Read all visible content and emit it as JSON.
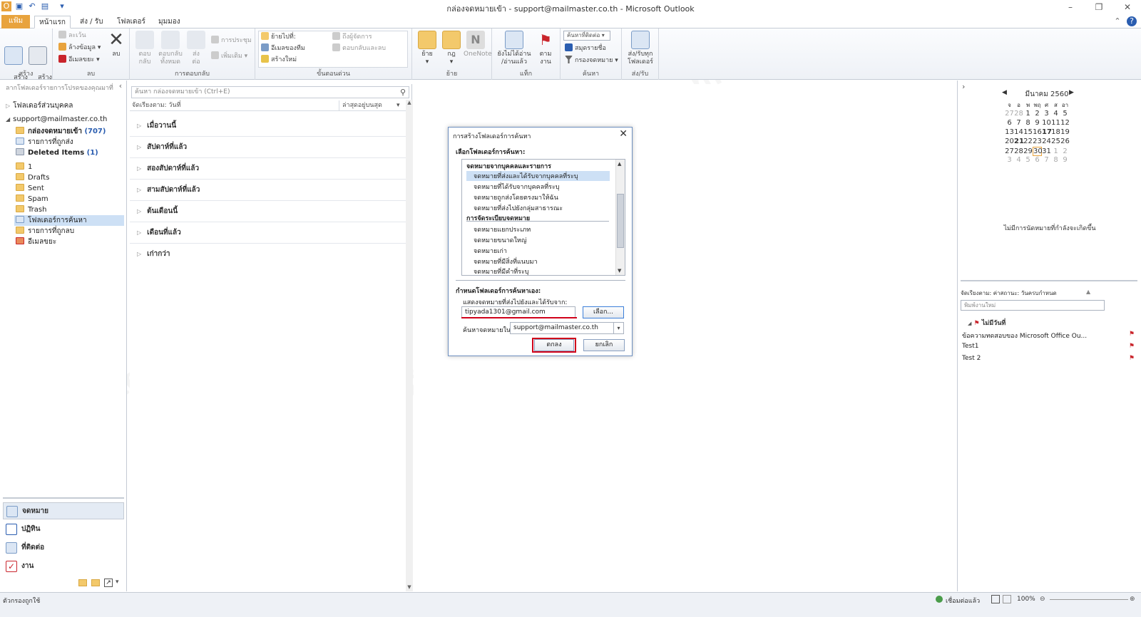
{
  "window": {
    "title": "กล่องจดหมายเข้า - support@mailmaster.co.th - Microsoft Outlook"
  },
  "tabs": [
    "แฟ้ม",
    "หน้าแรก",
    "ส่ง / รับ",
    "โฟลเดอร์",
    "มุมมอง"
  ],
  "ribbon": {
    "new_email": "สร้าง\nอีเมล",
    "new_items": "สร้าง\nรายการ",
    "ignore": "ละเว้น",
    "cleanup": "ล้างข้อมูล",
    "junk": "อีเมลขยะ",
    "delete": "ลบ",
    "group_new": "สร้าง",
    "group_delete": "ลบ",
    "reply": "ตอบ\nกลับ",
    "reply_all": "ตอบกลับ\nทั้งหมด",
    "forward": "ส่ง\nต่อ",
    "meeting": "การประชุม",
    "more": "เพิ่มเติม",
    "group_respond": "การตอบกลับ",
    "move_to": "ย้ายไปที่:",
    "team_email": "อีเมลของทีม",
    "create_new": "สร้างใหม่",
    "to_manager": "ถึงผู้จัดการ",
    "reply_delete": "ตอบกลับและลบ",
    "group_quicksteps": "ขั้นตอนด่วน",
    "move": "ย้าย",
    "rules": "กฎ",
    "onenote": "OneNote",
    "group_move": "ย้าย",
    "unread_read": "ยังไม่ได้อ่าน\n/อ่านแล้ว",
    "followup": "ตาม\nงาน",
    "group_tags": "แท็ก",
    "find_contact": "ค้นหาที่ติดต่อ",
    "address_book": "สมุดรายชื่อ",
    "filter_email": "กรองจดหมาย",
    "group_find": "ค้นหา",
    "send_receive_all": "ส่ง/รับทุก\nโฟลเดอร์",
    "group_send_receive": "ส่ง/รับ"
  },
  "nav": {
    "header": "ลากโฟลเดอร์รายการโปรดของคุณมาที่",
    "personal_folders": "โฟลเดอร์ส่วนบุคคล",
    "account": "support@mailmaster.co.th",
    "folders": [
      {
        "name": "กล่องจดหมายเข้า",
        "count": "(707)",
        "bold": true
      },
      {
        "name": "รายการที่ถูกส่ง",
        "count": ""
      },
      {
        "name": "Deleted Items",
        "count": "(1)",
        "bold": true
      },
      {
        "name": "1",
        "count": ""
      },
      {
        "name": "Drafts",
        "count": ""
      },
      {
        "name": "Sent",
        "count": ""
      },
      {
        "name": "Spam",
        "count": ""
      },
      {
        "name": "Trash",
        "count": ""
      },
      {
        "name": "โฟลเดอร์การค้นหา",
        "count": "",
        "selected": true
      },
      {
        "name": "รายการที่ถูกลบ",
        "count": ""
      },
      {
        "name": "อีเมลขยะ",
        "count": ""
      }
    ],
    "buttons": [
      "จดหมาย",
      "ปฏิทิน",
      "ที่ติดต่อ",
      "งาน"
    ]
  },
  "list": {
    "search_placeholder": "ค้นหา กล่องจดหมายเข้า (Ctrl+E)",
    "arrange_by": "จัดเรียงตาม: วันที่",
    "newest": "ล่าสุดอยู่บนสุด",
    "groups": [
      "เมื่อวานนี้",
      "สัปดาห์ที่แล้ว",
      "สองสัปดาห์ที่แล้ว",
      "สามสัปดาห์ที่แล้ว",
      "ต้นเดือนนี้",
      "เดือนที่แล้ว",
      "เก่ากว่า"
    ]
  },
  "calendar": {
    "month": "มีนาคม 2560",
    "weekdays": [
      "จ",
      "อ",
      "พ",
      "พฤ",
      "ศ",
      "ส",
      "อา"
    ],
    "weeks": [
      [
        "27",
        "28",
        "1",
        "2",
        "3",
        "4",
        "5"
      ],
      [
        "6",
        "7",
        "8",
        "9",
        "10",
        "11",
        "12"
      ],
      [
        "13",
        "14",
        "15",
        "16",
        "17",
        "18",
        "19"
      ],
      [
        "20",
        "21",
        "22",
        "23",
        "24",
        "25",
        "26"
      ],
      [
        "27",
        "28",
        "29",
        "30",
        "31",
        "1",
        "2"
      ],
      [
        "3",
        "4",
        "5",
        "6",
        "7",
        "8",
        "9"
      ]
    ],
    "no_appointments": "ไม่มีการนัดหมายที่กำลังจะเกิดขึ้น"
  },
  "tasks": {
    "arrange": "จัดเรียงตาม: ค่าสถานะ: วันครบกำหนด",
    "new_task_placeholder": "พิมพ์งานใหม่",
    "group": "ไม่มีวันที่",
    "items": [
      "ข้อความทดสอบของ Microsoft Office Ou...",
      "Test1",
      "Test 2"
    ]
  },
  "dialog": {
    "title": "การสร้างโฟลเดอร์การค้นหา",
    "select_label": "เลือกโฟลเดอร์การค้นหา:",
    "categories": [
      {
        "name": "จดหมายจากบุคคลและรายการ",
        "items": [
          "จดหมายที่ส่งและได้รับจากบุคคลที่ระบุ",
          "จดหมายที่ได้รับจากบุคคลที่ระบุ",
          "จดหมายถูกส่งโดยตรงมาให้ฉัน",
          "จดหมายที่ส่งไปยังกลุ่มสาธารณะ"
        ]
      },
      {
        "name": "การจัดระเบียบจดหมาย",
        "items": [
          "จดหมายแยกประเภท",
          "จดหมายขนาดใหญ่",
          "จดหมายเก่า",
          "จดหมายที่มีสิ่งที่แนบมา",
          "จดหมายที่มีคำที่ระบุ"
        ]
      }
    ],
    "custom_label": "กำหนดโฟลเดอร์การค้นหาเอง:",
    "show_mail_label": "แสดงจดหมายที่ส่งไปยังและได้รับจาก:",
    "email_value": "tipyada1301@gmail.com",
    "choose_button": "เลือก...",
    "search_in_label": "ค้นหาจดหมายใน:",
    "search_in_value": "support@mailmaster.co.th",
    "ok": "ตกลง",
    "cancel": "ยกเลิก"
  },
  "status": {
    "left": "ตัวกรองถูกใช้",
    "connection": "เชื่อมต่อแล้ว",
    "zoom": "100%"
  },
  "colors": {
    "accent": "#e8a33d",
    "selection": "#cde0f5",
    "highlight_red": "#d0021b",
    "flag_red": "#c9252c"
  }
}
